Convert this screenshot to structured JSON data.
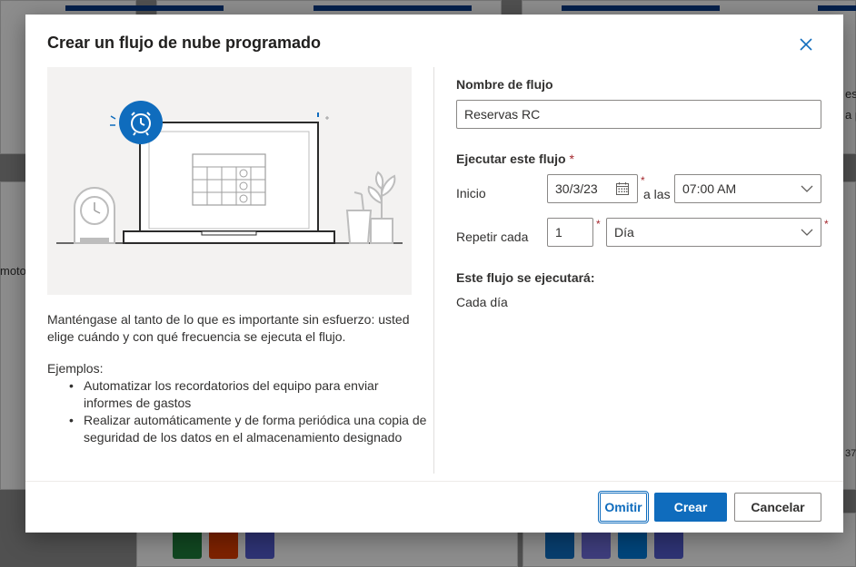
{
  "background": {
    "partial_texts": [
      "moto",
      "esc",
      "a p",
      "37"
    ]
  },
  "dialog": {
    "title": "Crear un flujo de nube programado",
    "close_icon": "close-icon",
    "left": {
      "description": "Manténgase al tanto de lo que es importante sin esfuerzo: usted elige cuándo y con qué frecuencia se ejecuta el flujo.",
      "examples_label": "Ejemplos:",
      "examples": [
        "Automatizar los recordatorios del equipo para enviar informes de gastos",
        "Realizar automáticamente y de forma periódica una copia de seguridad de los datos en el almacenamiento designado"
      ]
    },
    "form": {
      "flow_name_label": "Nombre de flujo",
      "flow_name_value": "Reservas RC",
      "run_label": "Ejecutar este flujo",
      "required_mark": "*",
      "start_label": "Inicio",
      "start_date": "30/3/23",
      "at_label": "a las",
      "start_time": "07:00 AM",
      "repeat_label": "Repetir cada",
      "repeat_value": "1",
      "repeat_unit": "Día",
      "summary_label": "Este flujo se ejecutará:",
      "summary_value": "Cada día"
    },
    "buttons": {
      "skip": "Omitir",
      "create": "Crear",
      "cancel": "Cancelar"
    }
  },
  "colors": {
    "primary": "#0f6cbd",
    "required": "#a4262c"
  }
}
